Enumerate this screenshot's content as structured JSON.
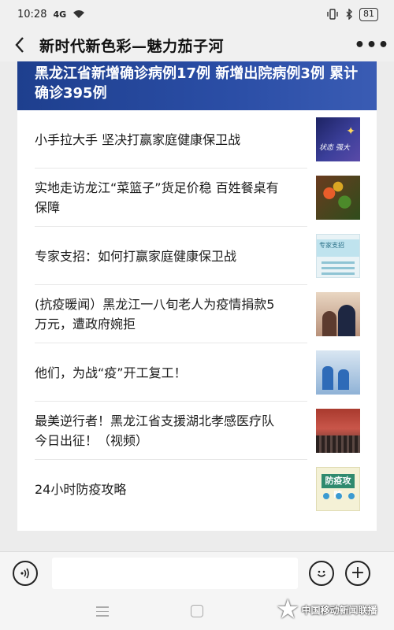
{
  "status_bar": {
    "time": "10:28",
    "signal": "4G",
    "battery": "81"
  },
  "nav": {
    "back_icon": "‹",
    "title": "新时代新色彩—魅力茄子河",
    "more_icon": "•••"
  },
  "headline": {
    "text": "黑龙江省新增确诊病例17例 新增出院病例3例 累计确诊395例"
  },
  "news": [
    {
      "title": "小手拉大手 坚决打赢家庭健康保卫战",
      "thumb_text": "状态  强大"
    },
    {
      "title": "实地走访龙江“菜篮子”货足价稳 百姓餐桌有保障"
    },
    {
      "title": "专家支招：如何打赢家庭健康保卫战",
      "thumb_text": "专家支招"
    },
    {
      "title": "(抗疫暖闻）黑龙江一八旬老人为疫情捐款5万元，遭政府婉拒"
    },
    {
      "title": "他们，为战“疫”开工复工！"
    },
    {
      "title": "最美逆行者！黑龙江省支援湖北孝感医疗队今日出征！（视频）"
    },
    {
      "title": "24小时防疫攻略",
      "thumb_text": "防疫攻略"
    }
  ],
  "bottom_bar": {
    "voice_icon": "voice-icon",
    "emoji_icon": "emoji-icon",
    "plus_icon": "+"
  },
  "watermark": {
    "text": "中国移动新闻联播"
  },
  "colors": {
    "banner": "#2b4ea6",
    "background": "#ececec"
  }
}
